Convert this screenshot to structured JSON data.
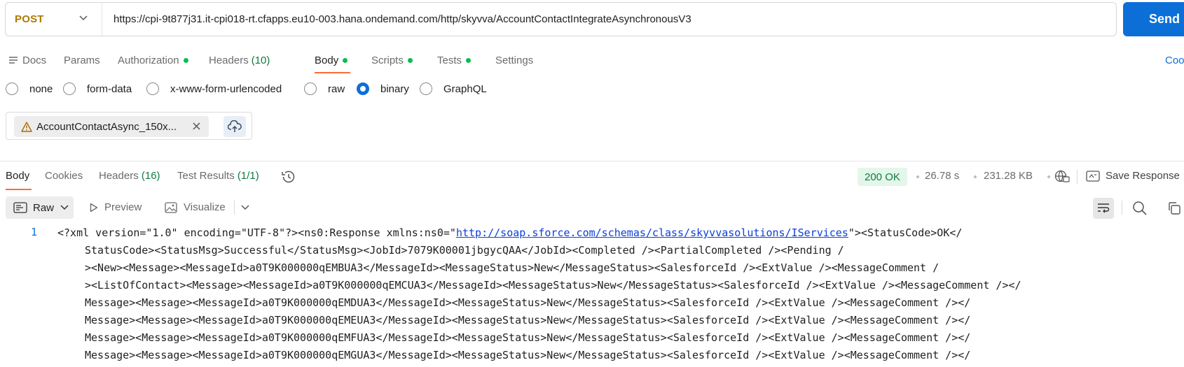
{
  "request": {
    "method": "POST",
    "url": "https://cpi-9t877j31.it-cpi018-rt.cfapps.eu10-003.hana.ondemand.com/http/skyvva/AccountContactIntegrateAsynchronousV3",
    "send_label": "Send"
  },
  "request_tabs": {
    "docs": "Docs",
    "params": "Params",
    "authorization": "Authorization",
    "headers": "Headers",
    "headers_count": "(10)",
    "body": "Body",
    "scripts": "Scripts",
    "tests": "Tests",
    "settings": "Settings",
    "cookies": "Coo"
  },
  "body_types": {
    "none": "none",
    "form_data": "form-data",
    "urlencoded": "x-www-form-urlencoded",
    "raw": "raw",
    "binary": "binary",
    "graphql": "GraphQL",
    "selected": "binary"
  },
  "file": {
    "name": "AccountContactAsync_150x..."
  },
  "response_tabs": {
    "body": "Body",
    "cookies": "Cookies",
    "headers": "Headers",
    "headers_count": "(16)",
    "test_results": "Test Results",
    "test_results_count": "(1/1)"
  },
  "response_meta": {
    "status": "200 OK",
    "time": "26.78 s",
    "size": "231.28 KB",
    "save_response": "Save Response"
  },
  "view_toolbar": {
    "raw": "Raw",
    "preview": "Preview",
    "visualize": "Visualize"
  },
  "response_body": {
    "line_number": "1",
    "line1_prefix": "<?xml version=\"1.0\" encoding=\"UTF-8\"?><ns0:Response xmlns:ns0=\"",
    "line1_link": "http://soap.sforce.com/schemas/class/skyvvasolutions/IServices",
    "line1_suffix": "\"><StatusCode>OK</",
    "lines": [
      "StatusCode><StatusMsg>Successful</StatusMsg><JobId>7079K00001jbgycQAA</JobId><Completed /><PartialCompleted /><Pending /",
      "><New><Message><MessageId>a0T9K000000qEMBUA3</MessageId><MessageStatus>New</MessageStatus><SalesforceId /><ExtValue /><MessageComment /",
      "><ListOfContact><Message><MessageId>a0T9K000000qEMCUA3</MessageId><MessageStatus>New</MessageStatus><SalesforceId /><ExtValue /><MessageComment /></",
      "Message><Message><MessageId>a0T9K000000qEMDUA3</MessageId><MessageStatus>New</MessageStatus><SalesforceId /><ExtValue /><MessageComment /></",
      "Message><Message><MessageId>a0T9K000000qEMEUA3</MessageId><MessageStatus>New</MessageStatus><SalesforceId /><ExtValue /><MessageComment /></",
      "Message><Message><MessageId>a0T9K000000qEMFUA3</MessageId><MessageStatus>New</MessageStatus><SalesforceId /><ExtValue /><MessageComment /></",
      "Message><Message><MessageId>a0T9K000000qEMGUA3</MessageId><MessageStatus>New</MessageStatus><SalesforceId /><ExtValue /><MessageComment /></"
    ]
  },
  "colors": {
    "accent": "#0c6fd8",
    "method": "#ad7a03",
    "active_tab_underline": "#ff6c37",
    "status_ok": "#0f7b3f",
    "dot_green": "#0cbb52"
  },
  "icons": [
    "docs-icon",
    "chevron-down-icon",
    "warning-icon",
    "close-icon",
    "cloud-upload-icon",
    "history-icon",
    "globe-icon",
    "save-icon",
    "raw-icon",
    "play-icon",
    "image-icon",
    "wrap-icon",
    "search-icon",
    "copy-icon"
  ]
}
